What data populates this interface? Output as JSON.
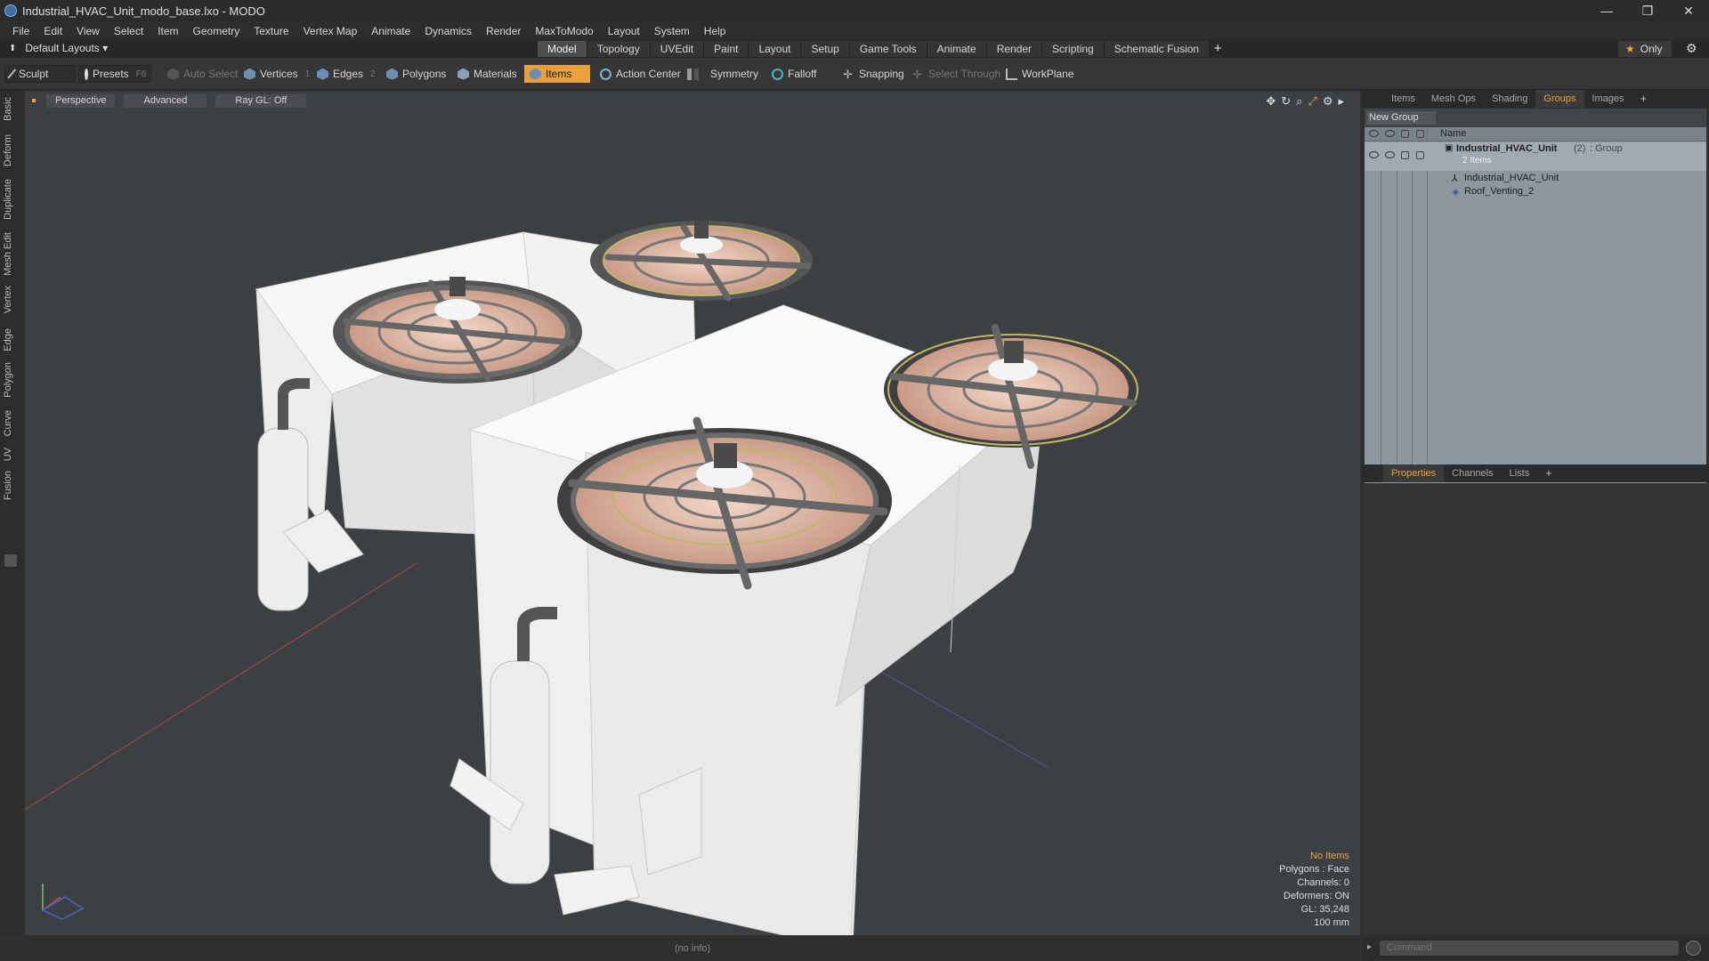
{
  "window": {
    "title": "Industrial_HVAC_Unit_modo_base.lxo - MODO",
    "minimize": "—",
    "restore": "❐",
    "close": "✕"
  },
  "menu": [
    "File",
    "Edit",
    "View",
    "Select",
    "Item",
    "Geometry",
    "Texture",
    "Vertex Map",
    "Animate",
    "Dynamics",
    "Render",
    "MaxToModo",
    "Layout",
    "System",
    "Help"
  ],
  "layouts": {
    "label": "Default Layouts ▾"
  },
  "tabs": [
    {
      "label": "Model",
      "active": true
    },
    {
      "label": "Topology"
    },
    {
      "label": "UVEdit"
    },
    {
      "label": "Paint"
    },
    {
      "label": "Layout"
    },
    {
      "label": "Setup"
    },
    {
      "label": "Game Tools"
    },
    {
      "label": "Animate"
    },
    {
      "label": "Render"
    },
    {
      "label": "Scripting"
    },
    {
      "label": "Schematic Fusion"
    }
  ],
  "only_label": "Only",
  "toolbar": {
    "sculpt": "Sculpt",
    "presets": "Presets",
    "presets_key": "F6",
    "auto_select": "Auto Select",
    "vertices": "Vertices",
    "vertices_num": "1",
    "edges": "Edges",
    "edges_num": "2",
    "polygons": "Polygons",
    "materials": "Materials",
    "items": "Items",
    "action_center": "Action Center",
    "symmetry": "Symmetry",
    "falloff": "Falloff",
    "snapping": "Snapping",
    "select_through": "Select Through",
    "workplane": "WorkPlane"
  },
  "left_tabs": [
    "Basic",
    "Deform",
    "Duplicate",
    "Mesh Edit",
    "Vertex",
    "Edge",
    "Polygon",
    "Curve",
    "UV",
    "Fusion"
  ],
  "viewport": {
    "view": "Perspective",
    "mode": "Advanced",
    "raygl": "Ray GL: Off",
    "info": {
      "items": "No Items",
      "polygons": "Polygons : Face",
      "channels": "Channels: 0",
      "deformers": "Deformers: ON",
      "gl": "GL: 35,248",
      "scale": "100 mm"
    }
  },
  "status": "(no info)",
  "panel_tabs": [
    {
      "label": "Items"
    },
    {
      "label": "Mesh Ops"
    },
    {
      "label": "Shading"
    },
    {
      "label": "Groups",
      "active": true
    },
    {
      "label": "Images"
    }
  ],
  "groups": {
    "new_group": "New Group",
    "col_name": "Name",
    "root": {
      "name": "Industrial_HVAC_Unit",
      "count": "(2)",
      "type": ": Group",
      "sub": "2 Items"
    },
    "children": [
      "Industrial_HVAC_Unit",
      "Roof_Venting_2"
    ]
  },
  "bottom_tabs": [
    {
      "label": "Properties",
      "active": true
    },
    {
      "label": "Channels"
    },
    {
      "label": "Lists"
    }
  ],
  "command_placeholder": "Command",
  "colors": {
    "accent": "#e8a13a",
    "viewport_bg": "#3d4043",
    "unit_white": "#f4f4f4"
  }
}
